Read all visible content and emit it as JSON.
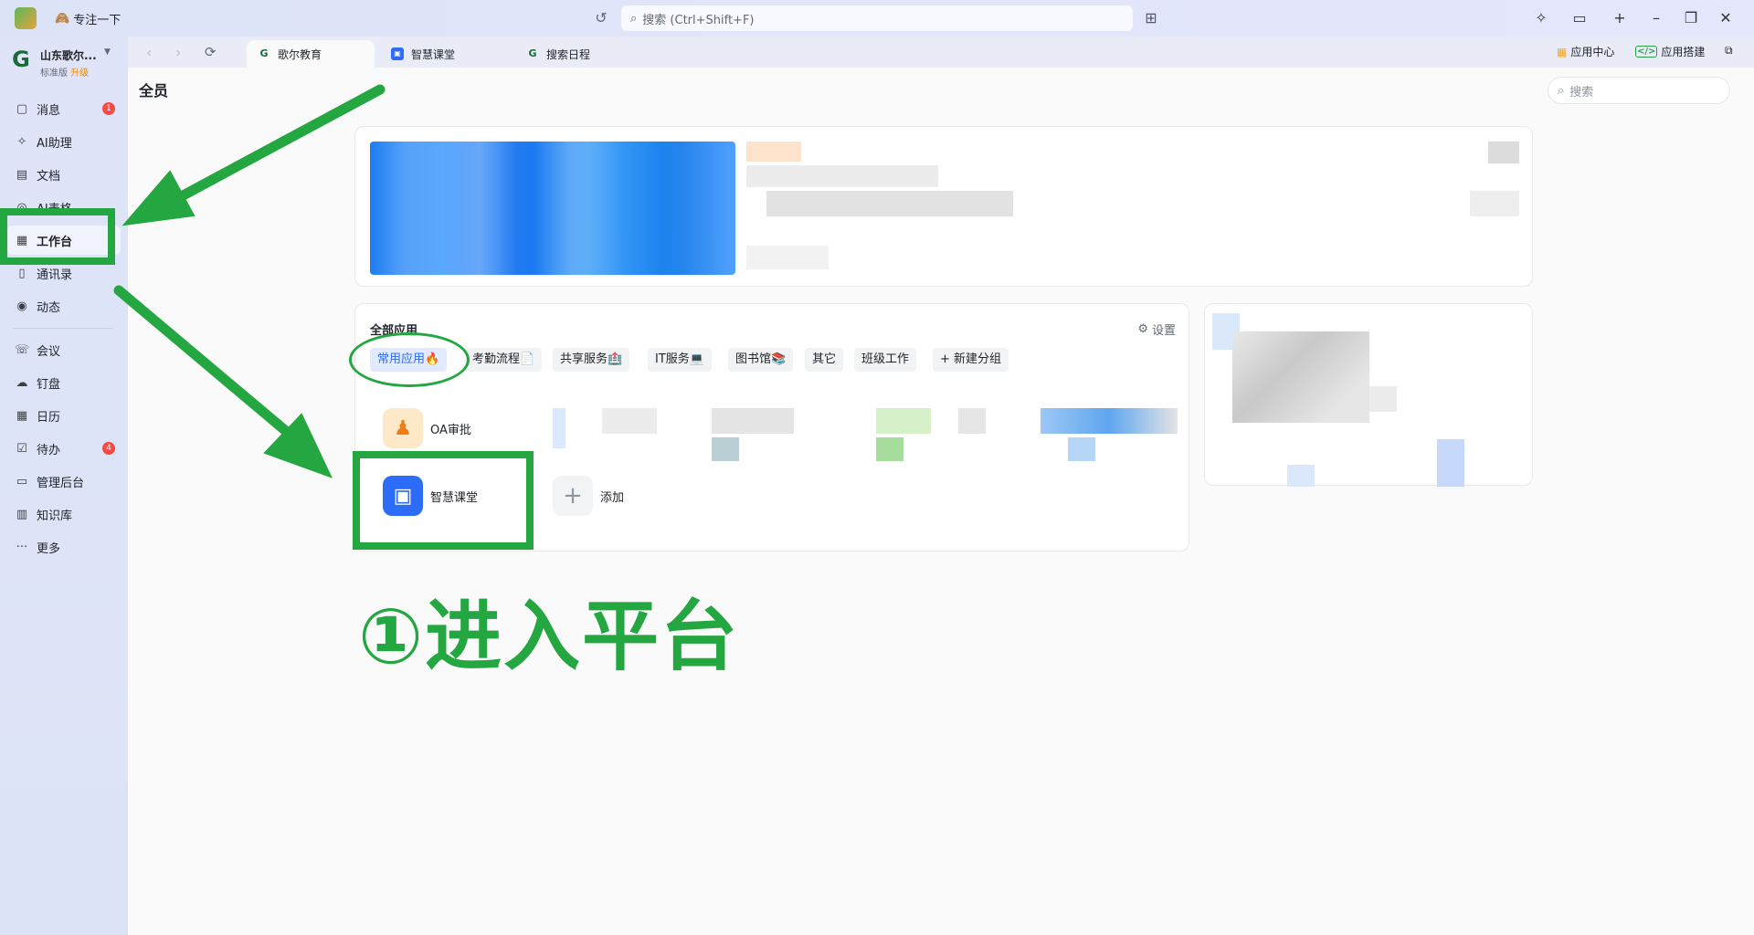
{
  "titlebar": {
    "focus_status": "专注一下",
    "search_placeholder": "搜索 (Ctrl+Shift+F)"
  },
  "sidebar": {
    "org_name": "山东歌尔...",
    "org_plan": "标准版",
    "org_upgrade": "升级",
    "items": [
      {
        "label": "消息",
        "icon": "message-icon",
        "badge": "1"
      },
      {
        "label": "AI助理",
        "icon": "ai-icon"
      },
      {
        "label": "文档",
        "icon": "doc-icon"
      },
      {
        "label": "AI表格",
        "icon": "table-icon"
      },
      {
        "label": "工作台",
        "icon": "grid-icon",
        "active": true
      },
      {
        "label": "通讯录",
        "icon": "contacts-icon"
      },
      {
        "label": "动态",
        "icon": "feed-icon"
      },
      {
        "label": "会议",
        "icon": "phone-icon"
      },
      {
        "label": "钉盘",
        "icon": "cloud-icon"
      },
      {
        "label": "日历",
        "icon": "calendar-icon"
      },
      {
        "label": "待办",
        "icon": "todo-icon",
        "badge": "4"
      },
      {
        "label": "管理后台",
        "icon": "monitor-icon"
      },
      {
        "label": "知识库",
        "icon": "book-icon"
      },
      {
        "label": "更多",
        "icon": "more-icon"
      }
    ]
  },
  "tabs": [
    {
      "label": "歌尔教育",
      "icon": "g-logo-icon",
      "active": true
    },
    {
      "label": "智慧课堂",
      "icon": "classroom-icon"
    },
    {
      "label": "搜索日程",
      "icon": "g-logo-icon"
    }
  ],
  "topright": {
    "app_center": "应用中心",
    "app_builder": "应用搭建"
  },
  "main": {
    "title": "全员",
    "search_placeholder": "搜索"
  },
  "apps": {
    "section_title": "全部应用",
    "settings_label": "设置",
    "categories": [
      "常用应用🔥",
      "考勤流程📄",
      "共享服务🏥",
      "IT服务💻",
      "图书馆📚",
      "其它",
      "班级工作",
      "+ 新建分组"
    ],
    "items": [
      {
        "label": "OA审批",
        "icon": "stamp-icon"
      },
      {
        "label": "智慧课堂",
        "icon": "classroom-icon"
      },
      {
        "label": "添加",
        "icon": "plus-icon"
      }
    ]
  },
  "annotation": {
    "step_text": "①进入平台"
  },
  "colors": {
    "accent": "#2c6cf6",
    "annotation_green": "#24a640",
    "badge_red": "#f54a45"
  }
}
